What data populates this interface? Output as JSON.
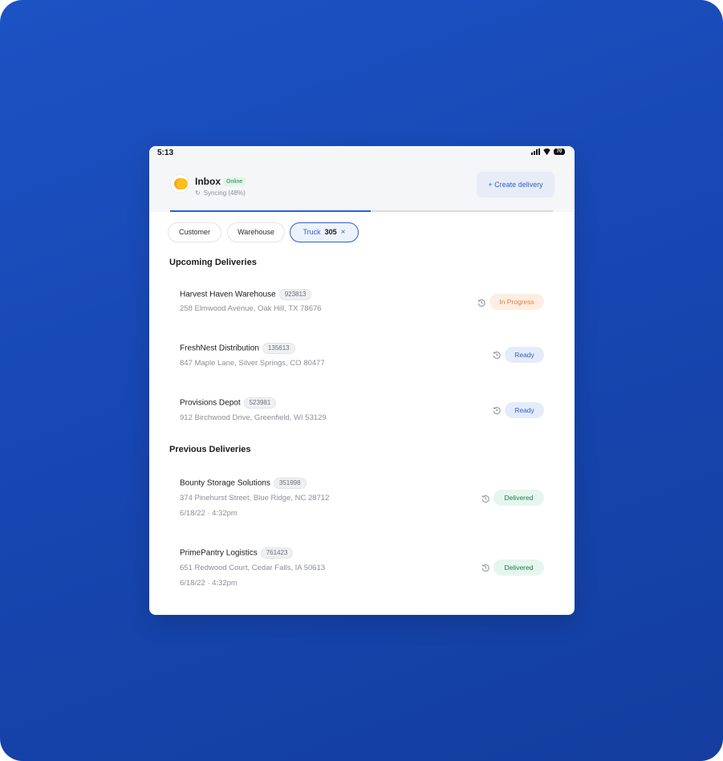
{
  "status_bar": {
    "time": "5:13",
    "battery": "70"
  },
  "header": {
    "title": "Inbox",
    "online_label": "Online",
    "sync_text": "Syncing (48%)",
    "create_button": "+ Create delivery"
  },
  "filters": {
    "customer": "Customer",
    "warehouse": "Warehouse",
    "truck_label": "Truck",
    "truck_value": "305",
    "remove": "×"
  },
  "sections": {
    "upcoming": "Upcoming Deliveries",
    "previous": "Previous Deliveries"
  },
  "upcoming": [
    {
      "name": "Harvest Haven Warehouse",
      "id": "923813",
      "address": "258 Elmwood Avenue, Oak Hill, TX 78676",
      "status": "In Progress"
    },
    {
      "name": "FreshNest Distribution",
      "id": "135613",
      "address": "847 Maple Lane, Silver Springs, CO 80477",
      "status": "Ready"
    },
    {
      "name": "Provisions Depot",
      "id": "523981",
      "address": "912 Birchwood Drive, Greenfield, WI 53129",
      "status": "Ready"
    }
  ],
  "previous": [
    {
      "name": "Bounty Storage Solutions",
      "id": "351998",
      "address": "374 Pinehurst Street, Blue Ridge, NC 28712",
      "date": "6/18/22 · 4:32pm",
      "status": "Delivered"
    },
    {
      "name": "PrimePantry Logistics",
      "id": "761423",
      "address": "651 Redwood Court, Cedar Falls, IA 50613",
      "date": "6/18/22 · 4:32pm",
      "status": "Delivered"
    }
  ],
  "icons": {
    "history": "history-icon",
    "sync": "sync-icon",
    "close": "close-icon"
  },
  "colors": {
    "accent": "#2f5fd0",
    "in_progress": "#e7813c",
    "delivered": "#1f7a4a",
    "background": "#1747b3"
  }
}
